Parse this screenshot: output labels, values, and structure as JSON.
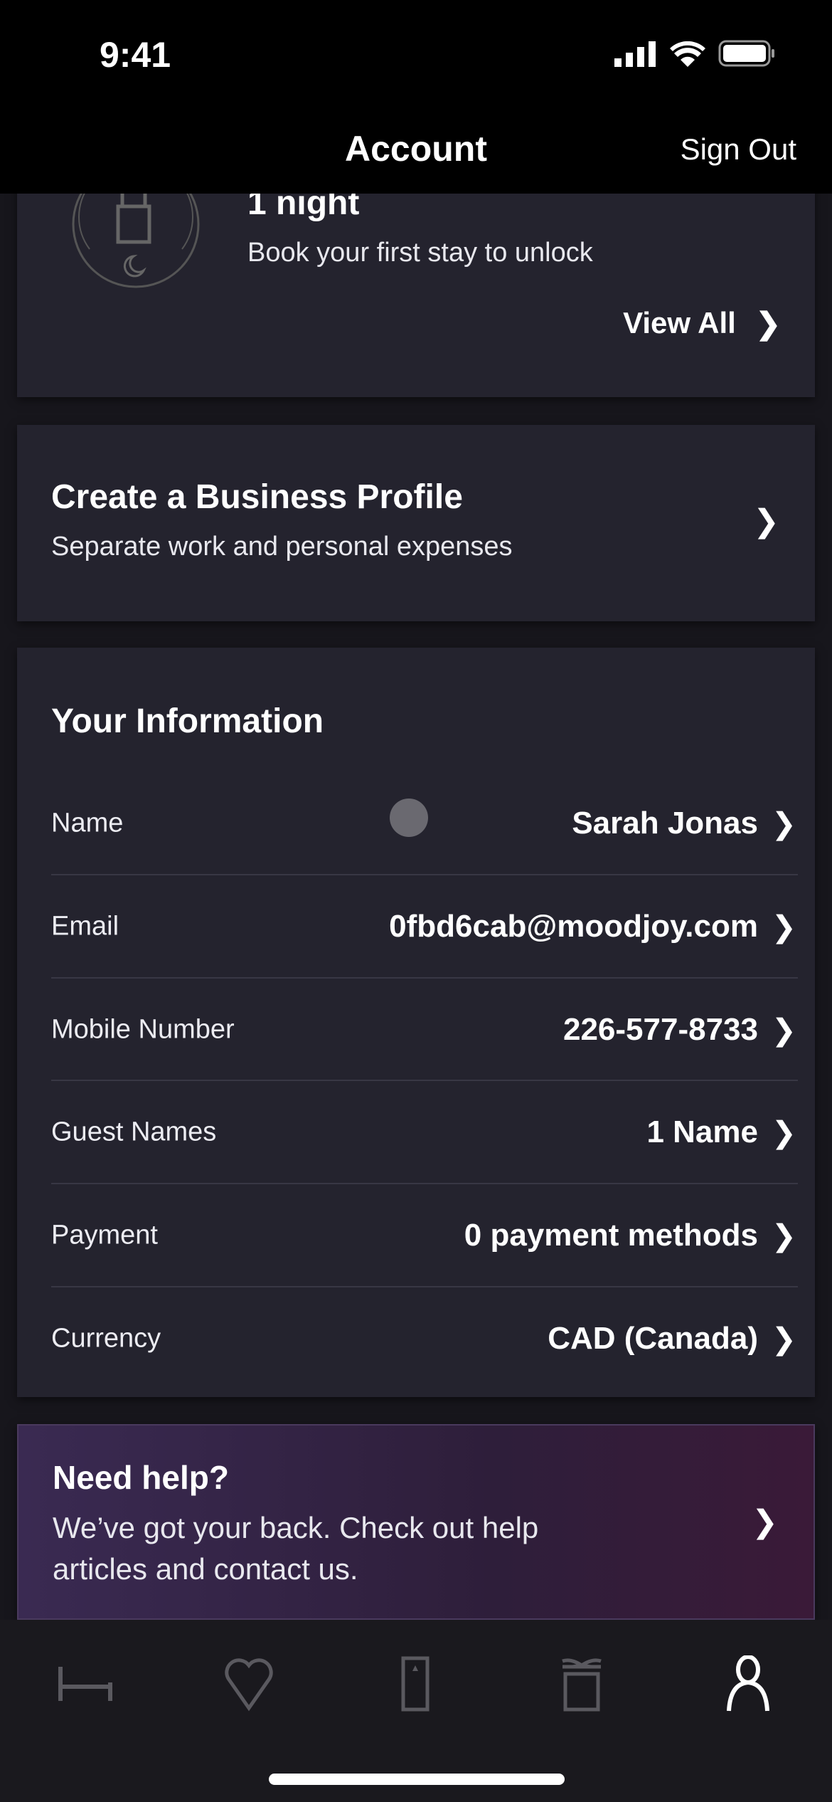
{
  "status_bar": {
    "time": "9:41"
  },
  "header": {
    "title": "Account",
    "sign_out": "Sign Out"
  },
  "rewards_card": {
    "title": "1 night",
    "subtitle": "Book your first stay to unlock",
    "view_all": "View All",
    "icon": "lock-moon-icon"
  },
  "business_card": {
    "title": "Create a Business Profile",
    "subtitle": "Separate work and personal expenses"
  },
  "info": {
    "title": "Your Information",
    "rows": [
      {
        "label": "Name",
        "value": "Sarah Jonas"
      },
      {
        "label": "Email",
        "value": "0fbd6cab@moodjoy.com"
      },
      {
        "label": "Mobile Number",
        "value": "226-577-8733"
      },
      {
        "label": "Guest Names",
        "value": "1 Name"
      },
      {
        "label": "Payment",
        "value": "0 payment methods"
      },
      {
        "label": "Currency",
        "value": "CAD (Canada)"
      }
    ]
  },
  "help_card": {
    "title": "Need help?",
    "line1": "We’ve got your back. Check out help",
    "line2": "articles and contact us."
  },
  "tabs": [
    {
      "icon": "bed-icon"
    },
    {
      "icon": "heart-icon"
    },
    {
      "icon": "door-icon"
    },
    {
      "icon": "gift-icon"
    },
    {
      "icon": "person-icon",
      "active": true
    }
  ],
  "colors": {
    "background": "#17161c",
    "card": "#24232e",
    "inactive_icon": "#5a595f"
  }
}
